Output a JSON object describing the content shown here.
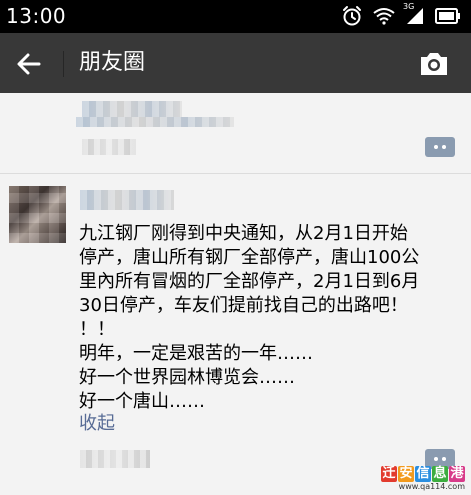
{
  "status_bar": {
    "time": "13:00",
    "network": "3G",
    "icons": [
      "alarm-icon",
      "wifi-icon",
      "signal-icon",
      "battery-icon"
    ]
  },
  "app_bar": {
    "title": "朋友圈",
    "back_icon": "arrow-left-icon",
    "camera_icon": "camera-icon",
    "background": "#383838"
  },
  "post": {
    "text_lines": [
      "九江钢厂刚得到中央通知，从2月1日开始",
      "停产，唐山所有钢厂全部停产，唐山100公",
      "里內所有冒烟的厂全部停产，2月1日到6月",
      "30日停产，车友们提前找自己的出路吧！",
      "！！",
      "明年，一定是艰苦的一年……",
      "好一个世界园林博览会……",
      "好一个唐山……"
    ],
    "collapse_label": "收起",
    "link_color": "#576b95"
  },
  "watermark": {
    "logo_chars": [
      "迁",
      "安",
      "信",
      "息",
      "港"
    ],
    "logo_colors": [
      "#e23b2e",
      "#f29a1d",
      "#2a8ee0",
      "#3cad3f",
      "#d83b8a"
    ],
    "url": "www.qa114.com"
  }
}
